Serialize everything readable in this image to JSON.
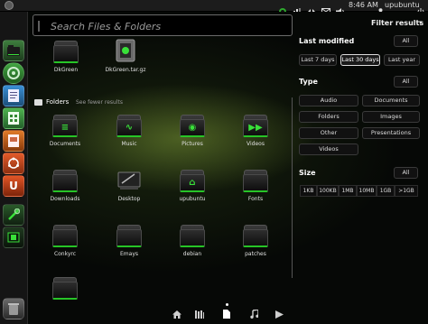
{
  "panel": {
    "clock": "8:46 AM",
    "user": "upubuntu"
  },
  "search": {
    "placeholder": "Search Files & Folders"
  },
  "top_items": [
    {
      "label": "DkGreen",
      "icon": "folder-icon"
    },
    {
      "label": "DkGreen.tar.gz",
      "icon": "archive-icon"
    }
  ],
  "folders_section": {
    "title": "Folders",
    "see_fewer": "See fewer results"
  },
  "folders": [
    {
      "label": "Documents",
      "icon": "documents-folder-icon"
    },
    {
      "label": "Music",
      "icon": "music-folder-icon"
    },
    {
      "label": "Pictures",
      "icon": "pictures-folder-icon"
    },
    {
      "label": "Videos",
      "icon": "videos-folder-icon"
    },
    {
      "label": "Downloads",
      "icon": "downloads-folder-icon"
    },
    {
      "label": "Desktop",
      "icon": "desktop-folder-icon"
    },
    {
      "label": "upubuntu",
      "icon": "home-folder-icon"
    },
    {
      "label": "Fonts",
      "icon": "fonts-folder-icon"
    },
    {
      "label": "Conkyrc",
      "icon": "folder-icon"
    },
    {
      "label": "Emays",
      "icon": "folder-icon"
    },
    {
      "label": "debian",
      "icon": "folder-icon"
    },
    {
      "label": "patches",
      "icon": "folder-icon"
    }
  ],
  "filter": {
    "title": "Filter results",
    "last_modified": {
      "heading": "Last modified",
      "all": "All",
      "options": [
        "Last 7 days",
        "Last 30 days",
        "Last year"
      ],
      "selected": "Last 30 days"
    },
    "type": {
      "heading": "Type",
      "all": "All",
      "options": [
        "Audio",
        "Documents",
        "Folders",
        "Images",
        "Other",
        "Presentations",
        "Videos"
      ]
    },
    "size": {
      "heading": "Size",
      "all": "All",
      "options": [
        "1KB",
        "100KB",
        "1MB",
        "10MB",
        "1GB",
        ">1GB"
      ]
    }
  },
  "lenses": [
    "home-lens-icon",
    "applications-lens-icon",
    "files-lens-icon",
    "music-lens-icon",
    "video-lens-icon"
  ],
  "colors": {
    "accent": "#2ec62e",
    "panel_bg": "#1c1c1c",
    "dash_bg": "#060806"
  }
}
